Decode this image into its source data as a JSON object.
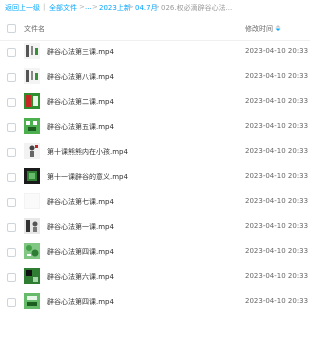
{
  "breadcrumb": {
    "back": "返回上一级",
    "sep1": "|",
    "all_files": "全部文件",
    "sep2": ">",
    "ellipsis": "...",
    "sep3": ">",
    "folder1": "2023上新",
    "sep4": ">",
    "folder2": "04.7月",
    "sep5": ">",
    "current": "026.权必滴辟谷心法..."
  },
  "columns": {
    "name": "文件名",
    "time": "修改时间"
  },
  "colors": {
    "link": "#06a7ff",
    "divider": "#f0f0f0"
  },
  "files": [
    {
      "name": "辟谷心法第三课.mp4",
      "time": "2023-04-10 20:33",
      "thumb": "calligraphy"
    },
    {
      "name": "辟谷心法第八课.mp4",
      "time": "2023-04-10 20:33",
      "thumb": "calligraphy"
    },
    {
      "name": "辟谷心法第二课.mp4",
      "time": "2023-04-10 20:33",
      "thumb": "red-green"
    },
    {
      "name": "辟谷心法第五课.mp4",
      "time": "2023-04-10 20:33",
      "thumb": "green-chars"
    },
    {
      "name": "第十课熊熊内在小孩.mp4",
      "time": "2023-04-10 20:33",
      "thumb": "figure"
    },
    {
      "name": "第十一课辟谷的意义.mp4",
      "time": "2023-04-10 20:33",
      "thumb": "dark-green"
    },
    {
      "name": "辟谷心法第七课.mp4",
      "time": "2023-04-10 20:33",
      "thumb": "blank"
    },
    {
      "name": "辟谷心法第一课.mp4",
      "time": "2023-04-10 20:33",
      "thumb": "figure-dark"
    },
    {
      "name": "辟谷心法第四课.mp4",
      "time": "2023-04-10 20:33",
      "thumb": "leafy"
    },
    {
      "name": "辟谷心法第六课.mp4",
      "time": "2023-04-10 20:33",
      "thumb": "green-dark"
    },
    {
      "name": "辟谷心法第四课.mp4",
      "time": "2023-04-10 20:33",
      "thumb": "green-bright"
    }
  ]
}
